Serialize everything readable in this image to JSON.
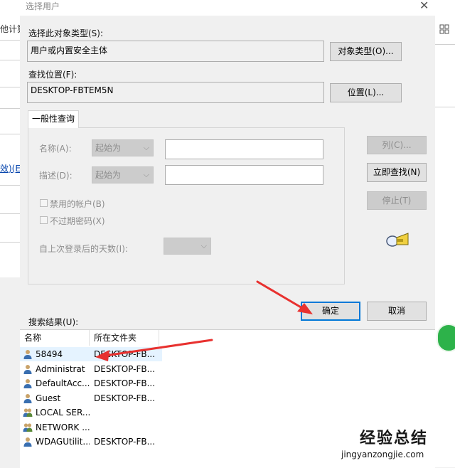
{
  "background": {
    "left_texts": [
      "他计算",
      "效)(E"
    ],
    "right_icon": "expand-icon"
  },
  "dialog": {
    "title": "选择用户",
    "close_glyph": "✕",
    "object_type": {
      "label": "选择此对象类型(S):",
      "value": "用户或内置安全主体",
      "button": "对象类型(O)..."
    },
    "location": {
      "label": "查找位置(F):",
      "value": "DESKTOP-FBTEM5N",
      "button": "位置(L)..."
    },
    "query": {
      "tab": "一般性查询",
      "name_label": "名称(A):",
      "name_combo": "起始为",
      "desc_label": "描述(D):",
      "desc_combo": "起始为",
      "disabled_accounts": "禁用的帐户(B)",
      "non_expiring": "不过期密码(X)",
      "days_label": "自上次登录后的天数(I):"
    },
    "side_buttons": {
      "columns": "列(C)...",
      "find_now": "立即查找(N)",
      "stop": "停止(T)"
    },
    "search_icon": "flashlight-search-icon",
    "ok": "确定",
    "cancel": "取消",
    "results": {
      "label": "搜索结果(U):",
      "columns": [
        "名称",
        "所在文件夹"
      ],
      "rows": [
        {
          "name": "58494",
          "folder": "DESKTOP-FB...",
          "icon": "user-icon",
          "selected": true
        },
        {
          "name": "Administrat",
          "folder": "DESKTOP-FB...",
          "icon": "user-icon"
        },
        {
          "name": "DefaultAcc...",
          "folder": "DESKTOP-FB...",
          "icon": "user-icon"
        },
        {
          "name": "Guest",
          "folder": "DESKTOP-FB...",
          "icon": "user-icon"
        },
        {
          "name": "LOCAL SER...",
          "folder": "",
          "icon": "group-icon"
        },
        {
          "name": "NETWORK ...",
          "folder": "",
          "icon": "group-icon"
        },
        {
          "name": "WDAGUtilit...",
          "folder": "DESKTOP-FB...",
          "icon": "user-icon"
        }
      ]
    }
  },
  "annotation": {
    "arrow_color": "#e8312f"
  },
  "watermark": {
    "title": "经验总结",
    "url": "jingyanzongjie.com"
  }
}
